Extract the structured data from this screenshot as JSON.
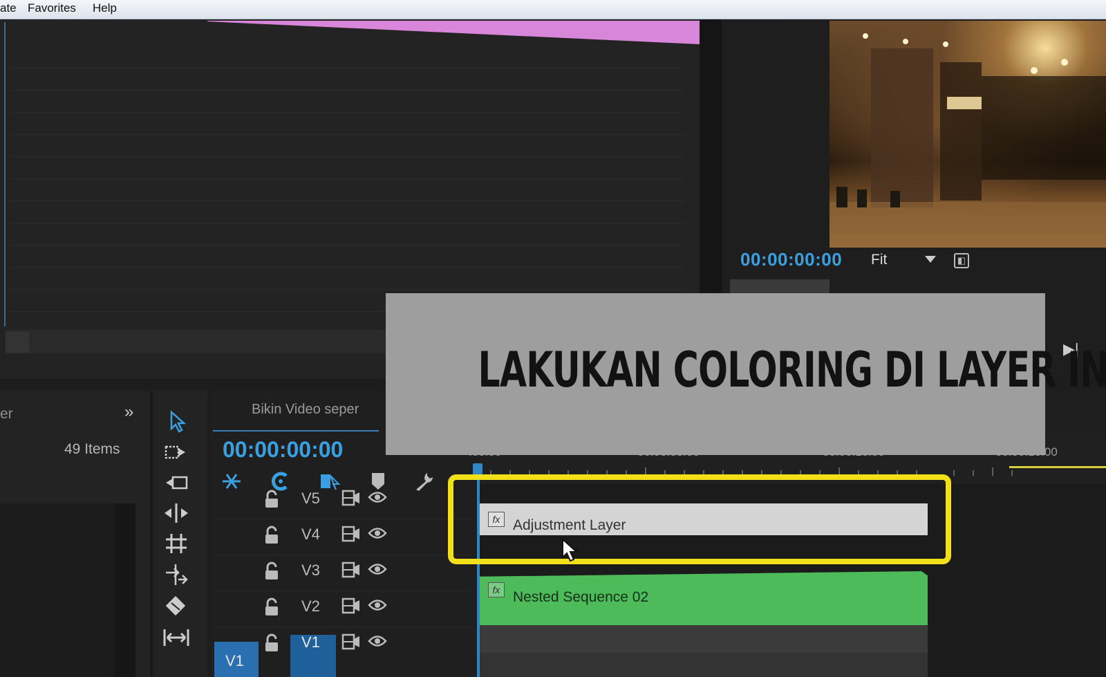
{
  "menu": {
    "items": [
      "ate",
      "Favorites",
      "Help"
    ]
  },
  "program_monitor": {
    "timecode": "00:00:00:00",
    "zoom": "Fit"
  },
  "overlay": {
    "caption": "LAKUKAN COLORING DI LAYER INI"
  },
  "project_panel": {
    "tab": "er",
    "item_count": "49 Items"
  },
  "timeline": {
    "tab": "Bikin Video seper",
    "timecode": "00:00:00:00",
    "ruler_labels": [
      ":00:00",
      "00:00:05:00",
      "00:00:10:00",
      "00:00:15:00"
    ],
    "tracks": [
      {
        "name": "V5"
      },
      {
        "name": "V4"
      },
      {
        "name": "V3"
      },
      {
        "name": "V2"
      },
      {
        "name": "V1"
      }
    ],
    "source_patch": "V1",
    "clips": {
      "adjustment": "Adjustment Layer",
      "nested": "Nested Sequence 02",
      "fx": "fx"
    }
  },
  "colors": {
    "accent": "#3aa0e0",
    "highlight": "#f2e11a",
    "nested_clip": "#4dbb5a",
    "adjustment_clip": "#d4d4d4"
  }
}
